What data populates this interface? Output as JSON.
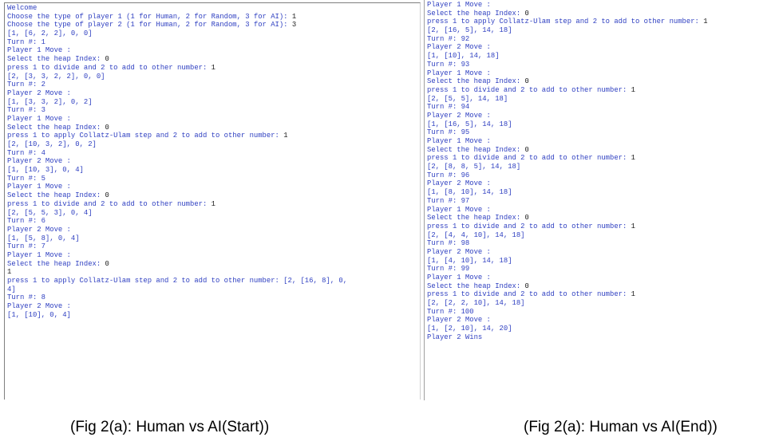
{
  "left_console": {
    "lines": [
      {
        "text": "Welcome",
        "input": ""
      },
      {
        "text": "Choose the type of player 1 (1 for Human, 2 for Random, 3 for AI): ",
        "input": "1"
      },
      {
        "text": "Choose the type of player 2 (1 for Human, 2 for Random, 3 for AI): ",
        "input": "3"
      },
      {
        "text": "[1, [6, 2, 2], 0, 0]",
        "input": ""
      },
      {
        "text": "Turn #: 1",
        "input": ""
      },
      {
        "text": "Player 1 Move :",
        "input": ""
      },
      {
        "text": "Select the heap Index: ",
        "input": "0"
      },
      {
        "text": "press 1 to divide and 2 to add to other number: ",
        "input": "1"
      },
      {
        "text": "[2, [3, 3, 2, 2], 0, 0]",
        "input": ""
      },
      {
        "text": "Turn #: 2",
        "input": ""
      },
      {
        "text": "Player 2 Move :",
        "input": ""
      },
      {
        "text": "[1, [3, 3, 2], 0, 2]",
        "input": ""
      },
      {
        "text": "Turn #: 3",
        "input": ""
      },
      {
        "text": "Player 1 Move :",
        "input": ""
      },
      {
        "text": "Select the heap Index: ",
        "input": "0"
      },
      {
        "text": "press 1 to apply Collatz-Ulam step and 2 to add to other number: ",
        "input": "1"
      },
      {
        "text": "[2, [10, 3, 2], 0, 2]",
        "input": ""
      },
      {
        "text": "Turn #: 4",
        "input": ""
      },
      {
        "text": "Player 2 Move :",
        "input": ""
      },
      {
        "text": "[1, [10, 3], 0, 4]",
        "input": ""
      },
      {
        "text": "Turn #: 5",
        "input": ""
      },
      {
        "text": "Player 1 Move :",
        "input": ""
      },
      {
        "text": "Select the heap Index: ",
        "input": "0"
      },
      {
        "text": "press 1 to divide and 2 to add to other number: ",
        "input": "1"
      },
      {
        "text": "[2, [5, 5, 3], 0, 4]",
        "input": ""
      },
      {
        "text": "Turn #: 6",
        "input": ""
      },
      {
        "text": "Player 2 Move :",
        "input": ""
      },
      {
        "text": "[1, [5, 8], 0, 4]",
        "input": ""
      },
      {
        "text": "Turn #: 7",
        "input": ""
      },
      {
        "text": "Player 1 Move :",
        "input": ""
      },
      {
        "text": "Select the heap Index: ",
        "input": "0"
      },
      {
        "text": "",
        "input": "1"
      },
      {
        "text": "press 1 to apply Collatz-Ulam step and 2 to add to other number: [2, [16, 8], 0,",
        "input": ""
      },
      {
        "text": "4]",
        "input": ""
      },
      {
        "text": "Turn #: 8",
        "input": ""
      },
      {
        "text": "Player 2 Move :",
        "input": ""
      },
      {
        "text": "[1, [10], 0, 4]",
        "input": ""
      }
    ]
  },
  "right_console": {
    "lines": [
      {
        "text": "Player 1 Move :",
        "input": ""
      },
      {
        "text": "Select the heap Index: ",
        "input": "0"
      },
      {
        "text": "press 1 to apply Collatz-Ulam step and 2 to add to other number: ",
        "input": "1"
      },
      {
        "text": "[2, [16, 5], 14, 18]",
        "input": ""
      },
      {
        "text": "Turn #: 92",
        "input": ""
      },
      {
        "text": "Player 2 Move :",
        "input": ""
      },
      {
        "text": "[1, [10], 14, 18]",
        "input": ""
      },
      {
        "text": "Turn #: 93",
        "input": ""
      },
      {
        "text": "Player 1 Move :",
        "input": ""
      },
      {
        "text": "Select the heap Index: ",
        "input": "0"
      },
      {
        "text": "press 1 to divide and 2 to add to other number: ",
        "input": "1"
      },
      {
        "text": "[2, [5, 5], 14, 18]",
        "input": ""
      },
      {
        "text": "Turn #: 94",
        "input": ""
      },
      {
        "text": "Player 2 Move :",
        "input": ""
      },
      {
        "text": "[1, [16, 5], 14, 18]",
        "input": ""
      },
      {
        "text": "Turn #: 95",
        "input": ""
      },
      {
        "text": "Player 1 Move :",
        "input": ""
      },
      {
        "text": "Select the heap Index: ",
        "input": "0"
      },
      {
        "text": "press 1 to divide and 2 to add to other number: ",
        "input": "1"
      },
      {
        "text": "[2, [8, 8, 5], 14, 18]",
        "input": ""
      },
      {
        "text": "Turn #: 96",
        "input": ""
      },
      {
        "text": "Player 2 Move :",
        "input": ""
      },
      {
        "text": "[1, [8, 10], 14, 18]",
        "input": ""
      },
      {
        "text": "Turn #: 97",
        "input": ""
      },
      {
        "text": "Player 1 Move :",
        "input": ""
      },
      {
        "text": "Select the heap Index: ",
        "input": "0"
      },
      {
        "text": "press 1 to divide and 2 to add to other number: ",
        "input": "1"
      },
      {
        "text": "[2, [4, 4, 10], 14, 18]",
        "input": ""
      },
      {
        "text": "Turn #: 98",
        "input": ""
      },
      {
        "text": "Player 2 Move :",
        "input": ""
      },
      {
        "text": "[1, [4, 10], 14, 18]",
        "input": ""
      },
      {
        "text": "Turn #: 99",
        "input": ""
      },
      {
        "text": "Player 1 Move :",
        "input": ""
      },
      {
        "text": "Select the heap Index: ",
        "input": "0"
      },
      {
        "text": "press 1 to divide and 2 to add to other number: ",
        "input": "1"
      },
      {
        "text": "[2, [2, 2, 10], 14, 18]",
        "input": ""
      },
      {
        "text": "Turn #: 100",
        "input": ""
      },
      {
        "text": "Player 2 Move :",
        "input": ""
      },
      {
        "text": "[1, [2, 10], 14, 20]",
        "input": ""
      },
      {
        "text": "Player 2 Wins",
        "input": ""
      }
    ]
  },
  "captions": {
    "left": "(Fig 2(a): Human vs AI(Start))",
    "right": "(Fig 2(a): Human vs AI(End))"
  },
  "colors": {
    "console_text": "#2e3fc1",
    "user_input": "#1a1a1a",
    "background": "#ffffff"
  }
}
